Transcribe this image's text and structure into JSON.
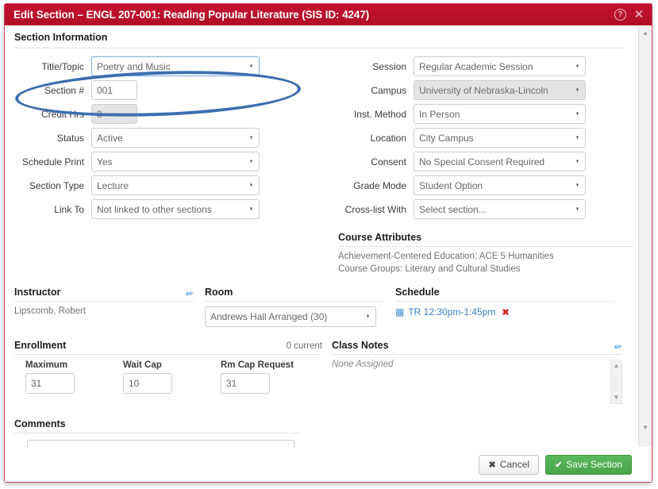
{
  "window": {
    "title": "Edit Section – ENGL 207-001: Reading Popular Literature (SIS ID: 4247)",
    "help_icon": "question-circle-icon",
    "close_icon": "close-icon",
    "help_glyph": "?",
    "close_glyph": "✕",
    "accent_color": "#bd1128",
    "border_color": "#c9465c"
  },
  "section_information": {
    "heading": "Section Information",
    "left_fields": [
      {
        "label": "Title/Topic",
        "value": "Poetry and Music",
        "type": "select",
        "state": "focused",
        "width": "w-title"
      },
      {
        "label": "Section #",
        "value": "001",
        "type": "text",
        "state": "normal",
        "width": "w-small"
      },
      {
        "label": "Credit Hrs",
        "value": "3",
        "type": "text",
        "state": "disabled",
        "width": "w-small"
      },
      {
        "label": "Status",
        "value": "Active",
        "type": "select",
        "state": "normal",
        "width": "w-sel"
      },
      {
        "label": "Schedule Print",
        "value": "Yes",
        "type": "select",
        "state": "normal",
        "width": "w-sel"
      },
      {
        "label": "Section Type",
        "value": "Lecture",
        "type": "select",
        "state": "normal",
        "width": "w-sel"
      },
      {
        "label": "Link To",
        "value": "Not linked to other sections",
        "type": "select",
        "state": "normal",
        "width": "w-sel"
      }
    ],
    "right_fields": [
      {
        "label": "Session",
        "value": "Regular Academic Session",
        "type": "select",
        "state": "normal",
        "width": "w-rsel"
      },
      {
        "label": "Campus",
        "value": "University of Nebraska-Lincoln",
        "type": "select",
        "state": "disabled",
        "width": "w-rsel"
      },
      {
        "label": "Inst. Method",
        "value": "In Person",
        "type": "select",
        "state": "normal",
        "width": "w-rsel"
      },
      {
        "label": "Location",
        "value": "City Campus",
        "type": "select",
        "state": "normal",
        "width": "w-rsel"
      },
      {
        "label": "Consent",
        "value": "No Special Consent Required",
        "type": "select",
        "state": "normal",
        "width": "w-rsel"
      },
      {
        "label": "Grade Mode",
        "value": "Student Option",
        "type": "select",
        "state": "normal",
        "width": "w-rsel"
      },
      {
        "label": "Cross-list With",
        "value": "Select section...",
        "type": "select",
        "state": "normal",
        "width": "w-rsel"
      }
    ]
  },
  "course_attributes": {
    "heading": "Course Attributes",
    "lines": [
      "Achievement-Centered Education: ACE 5 Humanities",
      "Course Groups: Literary and Cultural Studies"
    ]
  },
  "instructor": {
    "heading": "Instructor",
    "edit_icon": "pencil-icon",
    "edit_glyph": "✏",
    "value": "Lipscomb, Robert"
  },
  "room": {
    "heading": "Room",
    "value": "Andrews Hall Arranged (30)"
  },
  "schedule": {
    "heading": "Schedule",
    "calendar_icon": "calendar-icon",
    "calendar_glyph": "▦",
    "entry": "TR 12:30pm-1:45pm",
    "delete_icon": "delete-x-icon",
    "delete_glyph": "✖"
  },
  "enrollment": {
    "heading": "Enrollment",
    "current": "0 current",
    "fields": [
      {
        "label": "Maximum",
        "value": "31"
      },
      {
        "label": "Wait Cap",
        "value": "10"
      },
      {
        "label": "Rm Cap Request",
        "value": "31"
      }
    ]
  },
  "class_notes": {
    "heading": "Class Notes",
    "edit_icon": "pencil-icon",
    "edit_glyph": "✏",
    "value": "None Assigned"
  },
  "comments": {
    "heading": "Comments",
    "value": "",
    "placeholder": ""
  },
  "footer": {
    "cancel_label": "Cancel",
    "cancel_glyph": "✖",
    "save_label": "Save Section",
    "save_glyph": "✔"
  },
  "scrollbars": {
    "up_glyph": "▲",
    "down_glyph": "▼"
  },
  "annotation": {
    "type": "ellipse-highlight",
    "color": "#3b6fb0",
    "target": "Title/Topic"
  }
}
